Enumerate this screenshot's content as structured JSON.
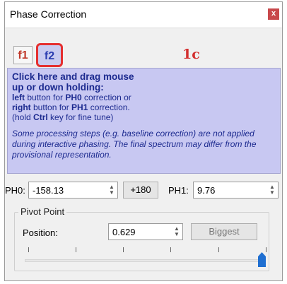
{
  "window": {
    "title": "Phase Correction",
    "close_label": "x"
  },
  "tabs": [
    {
      "label": "f1",
      "selected": false
    },
    {
      "label": "f2",
      "selected": true
    }
  ],
  "mode_label": "1c",
  "help": {
    "heading_line1": "Click here and drag mouse",
    "heading_line2": "up or down holding:",
    "left_bold": "left",
    "left_rest": " button for ",
    "ph0": "PH0",
    "left_tail": " correction or",
    "right_bold": "right",
    "right_rest": " button for ",
    "ph1": "PH1",
    "right_tail": " correction.",
    "hold_pre": "(hold ",
    "ctrl": "Ctrl",
    "hold_post": " key for fine tune)",
    "note": "Some processing steps (e.g. baseline correction) are not applied during interactive phasing. The final spectrum may differ from the provisional representation."
  },
  "ph0": {
    "label": "PH0:",
    "value": "-158.13"
  },
  "plus180": "+180",
  "ph1": {
    "label": "PH1:",
    "value": "9.76"
  },
  "pivot": {
    "group_title": "Pivot Point",
    "position_label": "Position:",
    "position_value": "0.629",
    "biggest_label": "Biggest",
    "slider_fraction": 1.0
  },
  "colors": {
    "help_bg": "#c8c8f2",
    "help_text": "#1c2a8f",
    "tab_highlight": "#e53030",
    "mode_label": "#d32f2f",
    "slider_thumb": "#1f6fd1"
  }
}
